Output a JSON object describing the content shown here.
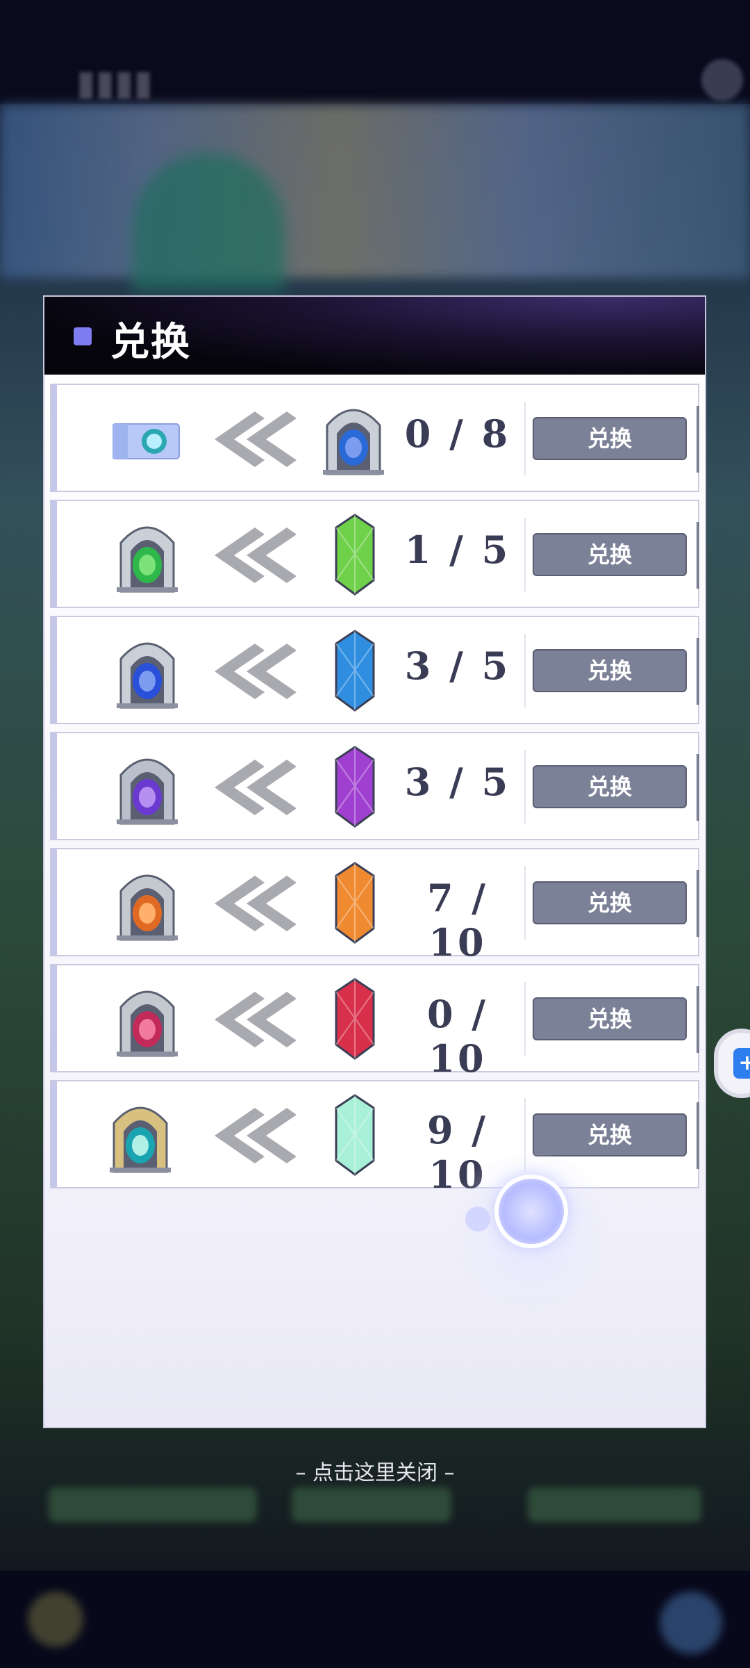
{
  "header": {
    "title": "兑换"
  },
  "close_hint": "– 点击这里关闭 –",
  "side_tab": {
    "glyph": "+"
  },
  "rows": [
    {
      "source": "ticket",
      "crystal_color": "#8aa0c8",
      "count": "0 / 8",
      "button": "兑换",
      "target": "gray-portal"
    },
    {
      "source": "gray-portal-green",
      "crystal_color": "#6fd04a",
      "count": "1 / 5",
      "button": "兑换"
    },
    {
      "source": "gray-portal-blue",
      "crystal_color": "#2f8ee0",
      "count": "3 / 5",
      "button": "兑换"
    },
    {
      "source": "purple-portal",
      "crystal_color": "#a040d0",
      "count": "3 / 5",
      "button": "兑换"
    },
    {
      "source": "orange-portal",
      "crystal_color": "#f08a30",
      "count": "7 / 10",
      "button": "兑换"
    },
    {
      "source": "red-portal",
      "crystal_color": "#d8304a",
      "count": "0 / 10",
      "button": "兑换"
    },
    {
      "source": "gold-portal",
      "crystal_color": "#a8f0d8",
      "count": "9 / 10",
      "button": "兑换"
    }
  ]
}
